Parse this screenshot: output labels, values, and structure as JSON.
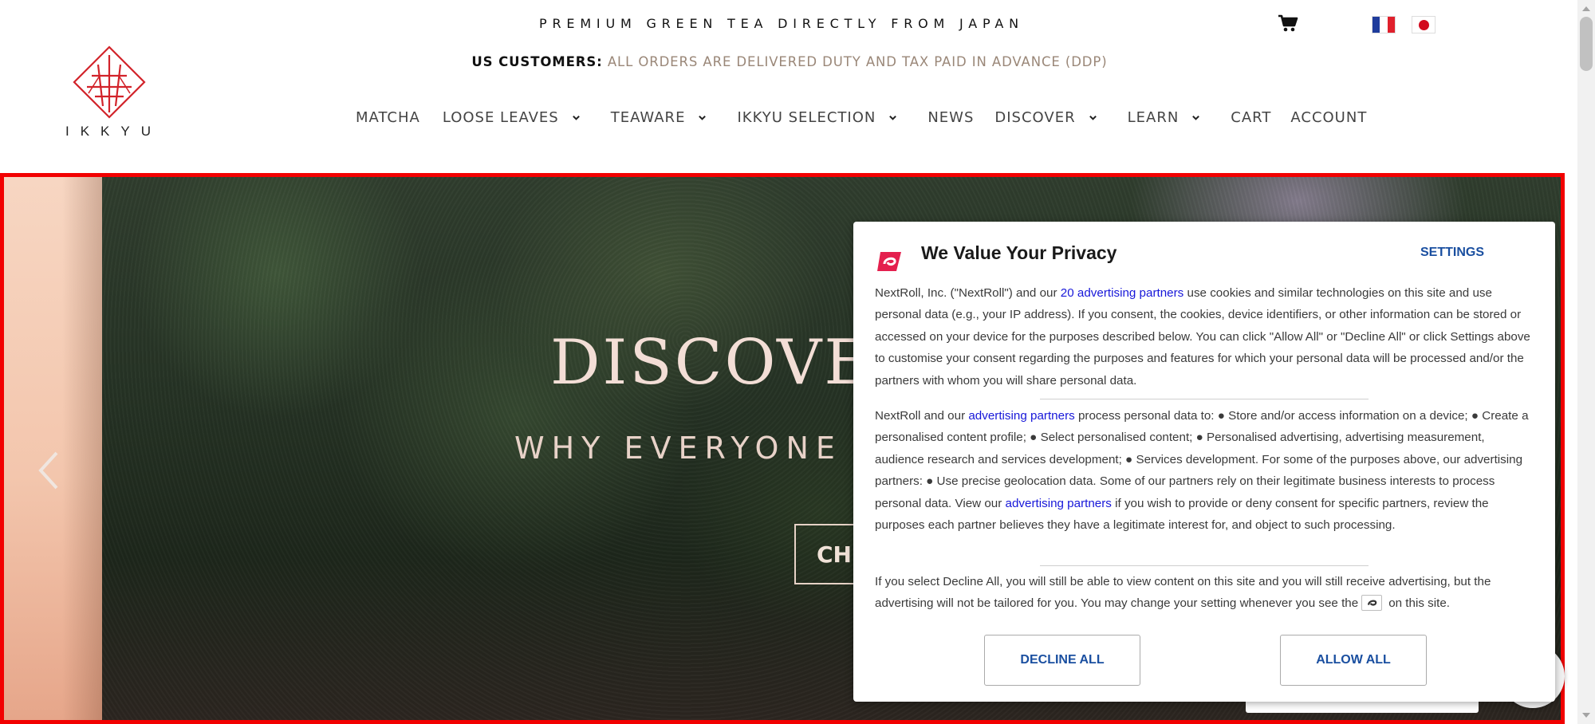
{
  "header": {
    "tagline": "PREMIUM GREEN TEA DIRECTLY FROM JAPAN",
    "us_label": "US CUSTOMERS:",
    "us_notice": "ALL ORDERS ARE DELIVERED DUTY AND TAX PAID IN ADVANCE (DDP)",
    "brand": "IKKYU",
    "icons": {
      "cart": "cart-icon",
      "french_flag": "flag-france-icon",
      "japan_flag": "flag-japan-icon"
    },
    "colors": {
      "brand_red": "#d2232a",
      "ddp_text": "#9a8778"
    }
  },
  "nav": {
    "items": [
      {
        "label": "MATCHA",
        "has_dropdown": false
      },
      {
        "label": "LOOSE LEAVES",
        "has_dropdown": true
      },
      {
        "label": "TEAWARE",
        "has_dropdown": true
      },
      {
        "label": "IKKYU SELECTION",
        "has_dropdown": true
      },
      {
        "label": "NEWS",
        "has_dropdown": false
      },
      {
        "label": "DISCOVER",
        "has_dropdown": true
      },
      {
        "label": "LEARN",
        "has_dropdown": true
      },
      {
        "label": "CART",
        "has_dropdown": false
      },
      {
        "label": "ACCOUNT",
        "has_dropdown": false
      }
    ]
  },
  "hero": {
    "title": "DISCOVER",
    "subtitle": "WHY EVERYONE",
    "cta": "CHE",
    "colors": {
      "highlight_border": "#f20000"
    }
  },
  "consent": {
    "title": "We Value Your Privacy",
    "settings": "SETTINGS",
    "p1": {
      "before": "NextRoll, Inc. (\"NextRoll\") and our ",
      "link": "20 advertising partners",
      "after": " use cookies and similar technologies on this site and use personal data (e.g., your IP address). If you consent, the cookies, device identifiers, or other information can be stored or accessed on your device for the purposes described below. You can click \"Allow All\" or \"Decline All\" or click Settings above to customise your consent regarding the purposes and features for which your personal data will be processed and/or the partners with whom you will share personal data."
    },
    "p2": {
      "before": "NextRoll and our ",
      "link1": "advertising partners",
      "middle": " process personal data to: ● Store and/or access information on a device; ● Create a personalised content profile; ● Select personalised content; ● Personalised advertising, advertising measurement, audience research and services development; ● Services development. For some of the purposes above, our advertising partners: ● Use precise geolocation data. Some of our partners rely on their legitimate business interests to process personal data. View our ",
      "link2": "advertising partners",
      "after": " if you wish to provide or deny consent for specific partners, review the purposes each partner believes they have a legitimate interest for, and object to such processing."
    },
    "p3": {
      "before": "If you select Decline All, you will still be able to view content on this site and you will still receive advertising, but the advertising will not be tailored for you. You may change your setting whenever you see the",
      "after": "on this site."
    },
    "decline": "DECLINE ALL",
    "allow": "ALLOW ALL",
    "colors": {
      "button_text": "#1a4fa0",
      "link": "#1717d9",
      "logo": "#e4204e"
    }
  }
}
